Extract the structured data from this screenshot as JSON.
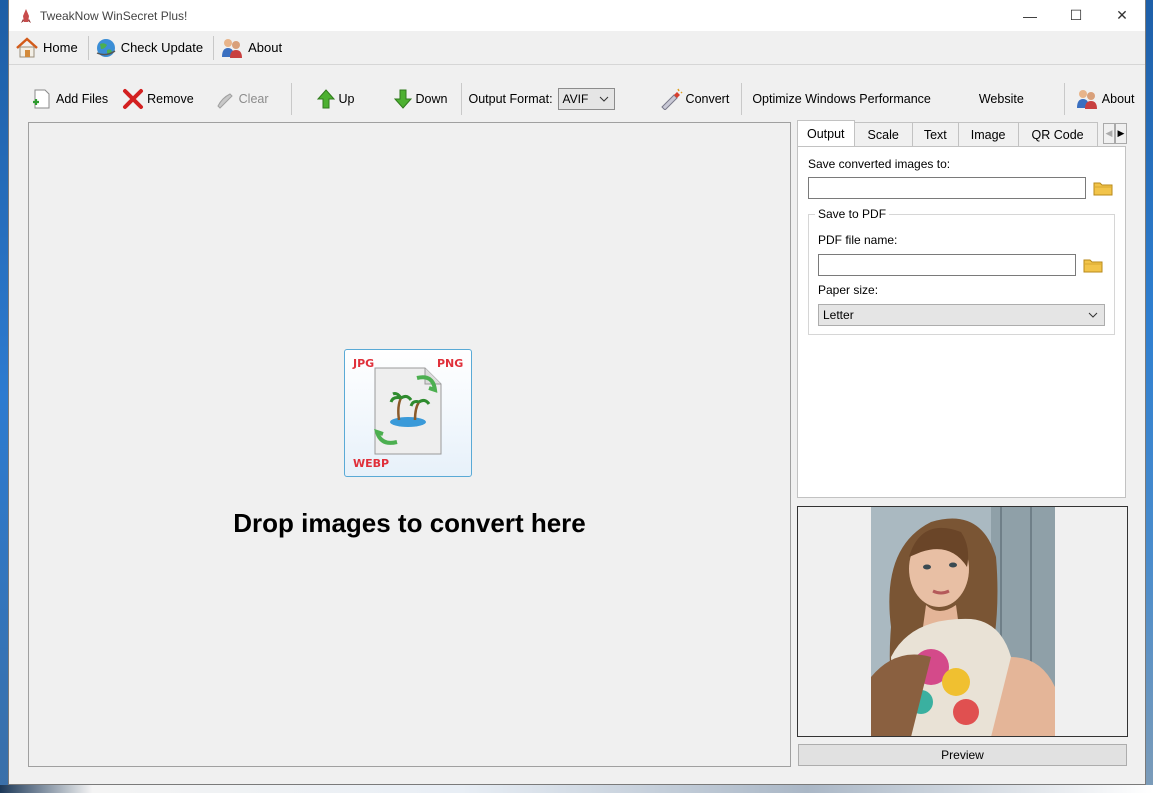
{
  "window": {
    "title": "TweakNow WinSecret Plus!",
    "controls": {
      "minimize": "—",
      "maximize": "☐",
      "close": "✕"
    }
  },
  "menubar": {
    "items": [
      {
        "label": "Home",
        "icon": "home-icon"
      },
      {
        "label": "Check Update",
        "icon": "globe-icon"
      },
      {
        "label": "About",
        "icon": "users-icon"
      }
    ]
  },
  "toolbar": {
    "add_files": "Add Files",
    "remove": "Remove",
    "clear": "Clear",
    "up": "Up",
    "down": "Down",
    "output_format_label": "Output Format:",
    "output_format_value": "AVIF",
    "convert": "Convert",
    "optimize": "Optimize Windows Performance",
    "website": "Website",
    "about": "About"
  },
  "droparea": {
    "badge_jpg": "JPG",
    "badge_png": "PNG",
    "badge_webp": "WEBP",
    "message": "Drop images to convert here"
  },
  "tabs": [
    {
      "label": "Output",
      "active": true
    },
    {
      "label": "Scale",
      "active": false
    },
    {
      "label": "Text",
      "active": false
    },
    {
      "label": "Image",
      "active": false
    },
    {
      "label": "QR Code",
      "active": false
    }
  ],
  "output_panel": {
    "save_to_label": "Save converted images to:",
    "save_to_value": "",
    "save_to_pdf_group": "Save to PDF",
    "pdf_name_label": "PDF file name:",
    "pdf_name_value": "",
    "paper_size_label": "Paper size:",
    "paper_size_value": "Letter"
  },
  "preview": {
    "button_label": "Preview"
  },
  "colors": {
    "window_bg": "#f0f0f0",
    "drop_card_border": "#5aaad6",
    "badge_red": "#e0303a"
  }
}
